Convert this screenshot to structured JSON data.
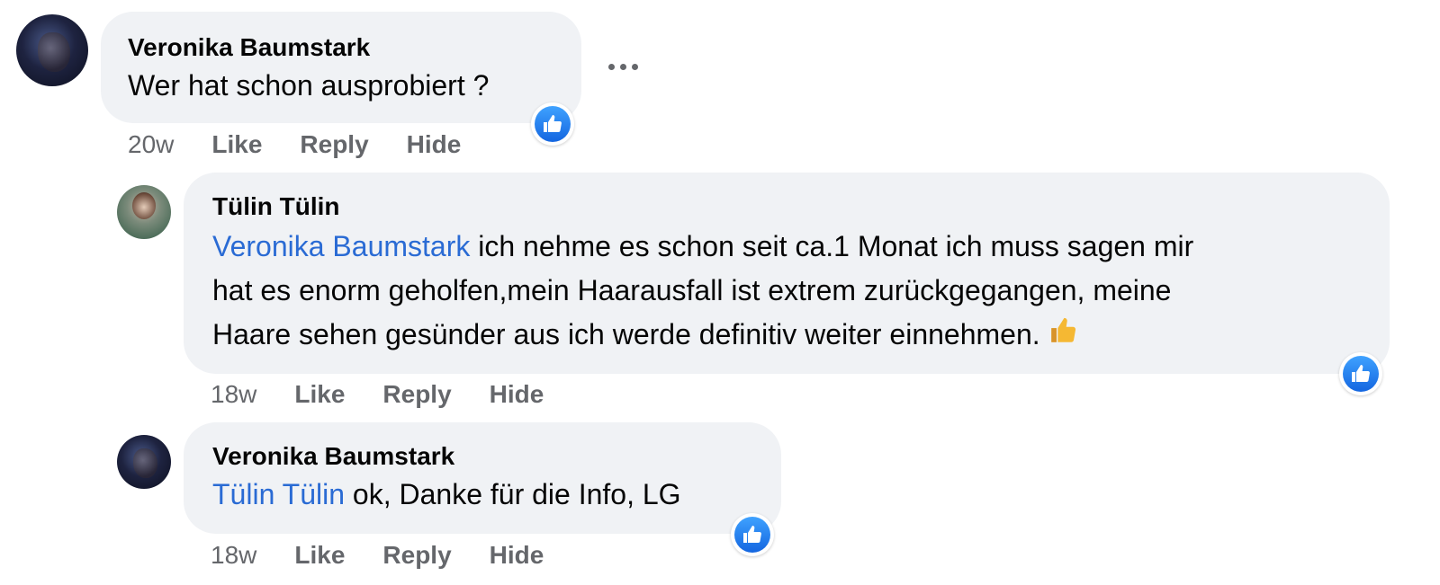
{
  "comments": [
    {
      "author": "Veronika Baumstark",
      "text": "Wer hat schon ausprobiert ?",
      "time": "20w",
      "actions": {
        "like": "Like",
        "reply": "Reply",
        "hide": "Hide"
      }
    },
    {
      "author": "Tülin Tülin",
      "mention": "Veronika Baumstark",
      "text_line1": " ich nehme es schon seit ca.1 Monat ich muss sagen mir",
      "text_line2": "hat es enorm geholfen,mein Haarausfall ist extrem zurückgegangen, meine",
      "text_line3": "Haare sehen gesünder aus ich werde definitiv weiter einnehmen.",
      "emoji": "thumbs-up-emoji",
      "time": "18w",
      "actions": {
        "like": "Like",
        "reply": "Reply",
        "hide": "Hide"
      }
    },
    {
      "author": "Veronika Baumstark",
      "mention": "Tülin Tülin",
      "text": " ok, Danke für die Info, LG",
      "time": "18w",
      "actions": {
        "like": "Like",
        "reply": "Reply",
        "hide": "Hide"
      }
    }
  ],
  "icons": {
    "reaction": "like-reaction-icon",
    "more": "more-options-icon"
  },
  "colors": {
    "bubble": "#f0f2f5",
    "mention": "#2a6bd4",
    "like_blue": "#1877f2",
    "meta": "#65676b"
  }
}
